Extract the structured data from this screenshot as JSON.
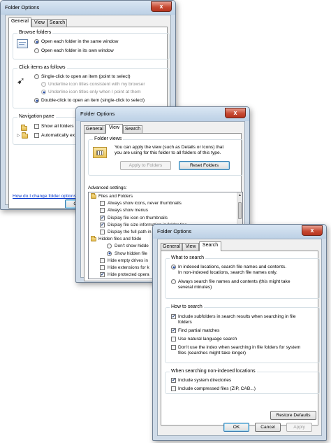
{
  "dialog1": {
    "title": "Folder Options",
    "close": "x",
    "tabs": [
      "General",
      "View",
      "Search"
    ],
    "browse_folders": {
      "legend": "Browse folders",
      "options": [
        "Open each folder in the same window",
        "Open each folder in its own window"
      ]
    },
    "click_items": {
      "legend": "Click items as follows",
      "options": [
        "Single-click to open an item (point to select)",
        "Underline icon titles consistent with my browser",
        "Underline icon titles only when I point at them",
        "Double-click to open an item (single-click to select)"
      ]
    },
    "navigation_pane": {
      "legend": "Navigation pane",
      "options": [
        "Show all folders",
        "Automatically ex"
      ]
    },
    "help_link": "How do I change folder options",
    "ok": "O"
  },
  "dialog2": {
    "title": "Folder Options",
    "close": "x",
    "tabs": [
      "General",
      "View",
      "Search"
    ],
    "folder_views": {
      "legend": "Folder views",
      "description": [
        "You can apply the view (such as Details or Icons) that",
        "you are using for this folder to all folders of this type."
      ],
      "apply": "Apply to Folders",
      "reset": "Reset Folders"
    },
    "advanced_label": "Advanced settings:",
    "tree": [
      {
        "type": "folder",
        "text": "Files and Folders"
      },
      {
        "type": "check",
        "checked": false,
        "text": "Always show icons, never thumbnails"
      },
      {
        "type": "check",
        "checked": false,
        "text": "Always show menus"
      },
      {
        "type": "check",
        "checked": true,
        "text": "Display file icon on thumbnails"
      },
      {
        "type": "check",
        "checked": true,
        "text": "Display file size information in folder tips"
      },
      {
        "type": "check",
        "checked": false,
        "text": "Display the full path in"
      },
      {
        "type": "folder",
        "text": "Hidden files and folde"
      },
      {
        "type": "radio",
        "checked": false,
        "text": "Don't show hidde"
      },
      {
        "type": "radio",
        "checked": true,
        "text": "Show hidden file"
      },
      {
        "type": "check",
        "checked": false,
        "text": "Hide empty drives in"
      },
      {
        "type": "check",
        "checked": false,
        "text": "Hide extensions for k"
      },
      {
        "type": "check",
        "checked": true,
        "text": "Hide protected opera"
      }
    ]
  },
  "dialog3": {
    "title": "Folder Options",
    "close": "x",
    "tabs": [
      "General",
      "View",
      "Search"
    ],
    "what_to_search": {
      "legend": "What to search",
      "options": [
        [
          "In indexed locations, search file names and contents.",
          "In non-indexed locations, search file names only."
        ],
        [
          "Always search file names and contents (this might take",
          "several minutes)"
        ]
      ]
    },
    "how_to_search": {
      "legend": "How to search",
      "options": [
        {
          "checked": true,
          "lines": [
            "Include subfolders in search results when searching in file",
            "folders"
          ]
        },
        {
          "checked": true,
          "lines": [
            "Find partial matches"
          ]
        },
        {
          "checked": false,
          "lines": [
            "Use natural language search"
          ]
        },
        {
          "checked": false,
          "lines": [
            "Don't use the index when searching in file folders for system",
            "files (searches might take longer)"
          ]
        }
      ]
    },
    "non_indexed": {
      "legend": "When searching non-indexed locations",
      "options": [
        {
          "checked": true,
          "text": "Include system directories"
        },
        {
          "checked": false,
          "text": "Include compressed files (ZIP, CAB...)"
        }
      ]
    },
    "restore": "Restore Defaults",
    "ok": "OK",
    "cancel": "Cancel",
    "apply": "Apply"
  }
}
